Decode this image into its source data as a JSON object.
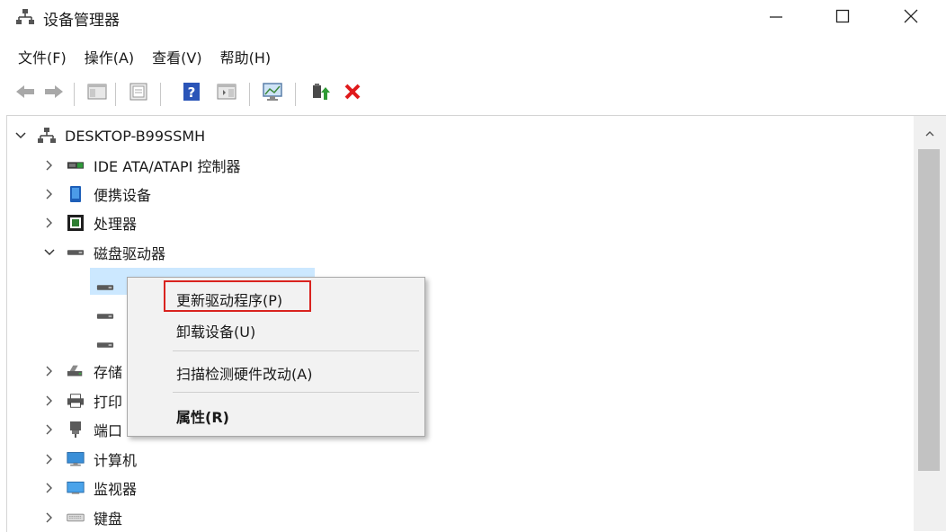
{
  "window": {
    "title": "设备管理器",
    "app_icon": "device-manager-icon",
    "controls": [
      "minimize-icon",
      "maximize-icon",
      "close-icon"
    ]
  },
  "menu": [
    "文件(F)",
    "操作(A)",
    "查看(V)",
    "帮助(H)"
  ],
  "toolbar": {
    "buttons": [
      "back-arrow-icon",
      "forward-arrow-icon",
      "show-hide-console-tree-icon",
      "properties-icon",
      "help-icon",
      "action-pane-icon",
      "scan-hardware-monitor-icon",
      "update-driver-icon",
      "uninstall-x-icon"
    ]
  },
  "tree": {
    "root": "DESKTOP-B99SSMH",
    "categories": [
      {
        "label": "IDE ATA/ATAPI 控制器",
        "icon": "ide-controller-icon",
        "expanded": false
      },
      {
        "label": "便携设备",
        "icon": "portable-device-icon",
        "expanded": false
      },
      {
        "label": "处理器",
        "icon": "processor-icon",
        "expanded": false
      },
      {
        "label": "磁盘驱动器",
        "icon": "disk-drive-icon",
        "expanded": true
      },
      {
        "label": "存储",
        "icon": "storage-controller-icon",
        "expanded": false
      },
      {
        "label": "打印",
        "icon": "print-queue-icon",
        "expanded": false
      },
      {
        "label": "端口",
        "icon": "port-icon",
        "expanded": false
      },
      {
        "label": "计算机",
        "icon": "computer-icon",
        "expanded": false
      },
      {
        "label": "监视器",
        "icon": "monitor-icon",
        "expanded": false
      },
      {
        "label": "键盘",
        "icon": "keyboard-icon",
        "expanded": false
      }
    ],
    "disk_children_icon": "disk-drive-icon"
  },
  "context_menu": {
    "items": [
      "更新驱动程序(P)",
      "卸载设备(U)",
      "扫描检测硬件改动(A)",
      "属性(R)"
    ],
    "highlighted_item": "更新驱动程序(P)"
  },
  "colors": {
    "highlight_border": "#d9231f",
    "menu_background": "#f2f2f2",
    "selection": "#cce8ff"
  }
}
